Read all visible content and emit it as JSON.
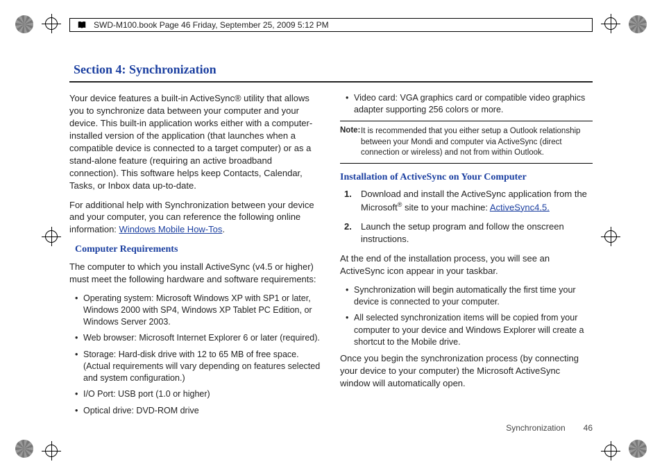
{
  "header": {
    "text": "SWD-M100.book  Page 46  Friday, September 25, 2009  5:12 PM"
  },
  "section": {
    "title": "Section 4: Synchronization"
  },
  "left": {
    "intro": "Your device features a built-in ActiveSync® utility that allows you to synchronize data between your computer and your device. This built-in application works either with a computer-installed version of the application (that launches when a compatible device is connected to a target computer) or as a stand-alone feature (requiring an active broadband connection). This software helps keep Contacts, Calendar, Tasks, or Inbox data up-to-date.",
    "help_pre": "For additional help with Synchronization between your device and your computer, you can reference the following online information: ",
    "help_link": "Windows Mobile How-Tos",
    "help_post": ".",
    "req_heading": "Computer Requirements",
    "req_intro": "The computer to which you install ActiveSync (v4.5 or higher) must meet the following hardware and software requirements:",
    "reqs": [
      "Operating system: Microsoft Windows XP with SP1 or later, Windows 2000 with SP4, Windows XP Tablet PC Edition, or Windows Server 2003.",
      "Web browser: Microsoft Internet Explorer 6 or later (required).",
      "Storage: Hard-disk drive with 12 to 65 MB of free space. (Actual requirements will vary depending on features selected and system configuration.)",
      "I/O Port: USB port (1.0 or higher)",
      "Optical drive: DVD-ROM drive"
    ]
  },
  "right": {
    "video_req": "Video card: VGA graphics card or compatible video graphics adapter supporting 256 colors or more.",
    "note_label": "Note:",
    "note_body": "It is recommended that you either setup a Outlook relationship between your Mondi and computer via ActiveSync (direct connection or wireless) and not from within Outlook.",
    "install_heading": "Installation of ActiveSync on Your Computer",
    "step1_pre": "Download and install the ActiveSync application from the Microsoft",
    "step1_mid": " site to your machine: ",
    "step1_link": "ActiveSync4.5.",
    "step2": "Launch the setup program and follow the onscreen instructions.",
    "after1": "At the end of the installation process, you will see an ActiveSync icon appear in your taskbar.",
    "bullets": [
      "Synchronization will begin automatically the first time your device is connected to your computer.",
      "All selected synchronization items will be copied from your computer to your device and Windows Explorer will create a shortcut to the Mobile drive."
    ],
    "after2": "Once you begin the synchronization process (by connecting your device to your computer) the Microsoft ActiveSync window will automatically open."
  },
  "footer": {
    "label": "Synchronization",
    "page": "46"
  }
}
